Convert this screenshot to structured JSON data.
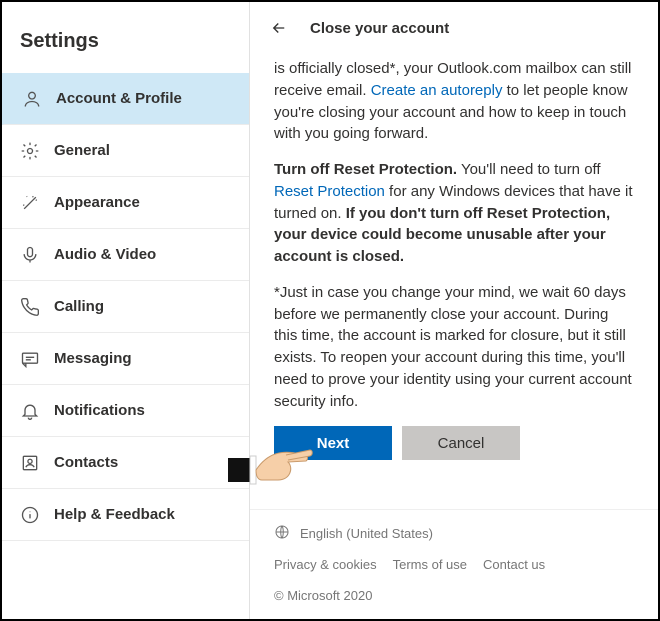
{
  "sidebar": {
    "title": "Settings",
    "items": [
      {
        "label": "Account & Profile",
        "icon": "user-icon",
        "active": true
      },
      {
        "label": "General",
        "icon": "gear-icon"
      },
      {
        "label": "Appearance",
        "icon": "wand-icon"
      },
      {
        "label": "Audio & Video",
        "icon": "mic-icon"
      },
      {
        "label": "Calling",
        "icon": "phone-icon"
      },
      {
        "label": "Messaging",
        "icon": "message-icon"
      },
      {
        "label": "Notifications",
        "icon": "bell-icon"
      },
      {
        "label": "Contacts",
        "icon": "contacts-icon"
      },
      {
        "label": "Help & Feedback",
        "icon": "info-icon"
      }
    ]
  },
  "header": {
    "title": "Close your account"
  },
  "body": {
    "p1_a": "is officially closed*, your Outlook.com mailbox can still receive email. ",
    "p1_link": "Create an autoreply",
    "p1_b": " to let people know you're closing your account and how to keep in touch with you going forward.",
    "p2_bold1": "Turn off Reset Protection.",
    "p2_a": " You'll need to turn off ",
    "p2_link": "Reset Protection",
    "p2_b": " for any Windows devices that have it turned on. ",
    "p2_bold2": "If you don't turn off Reset Protection, your device could become unusable after your account is closed.",
    "p3": "*Just in case you change your mind, we wait 60 days before we permanently close your account. During this time, the account is marked for closure, but it still exists. To reopen your account during this time, you'll need to prove your identity using your current account security info."
  },
  "buttons": {
    "next": "Next",
    "cancel": "Cancel"
  },
  "footer": {
    "language": "English (United States)",
    "privacy": "Privacy & cookies",
    "terms": "Terms of use",
    "contact": "Contact us",
    "copyright": "© Microsoft 2020"
  }
}
